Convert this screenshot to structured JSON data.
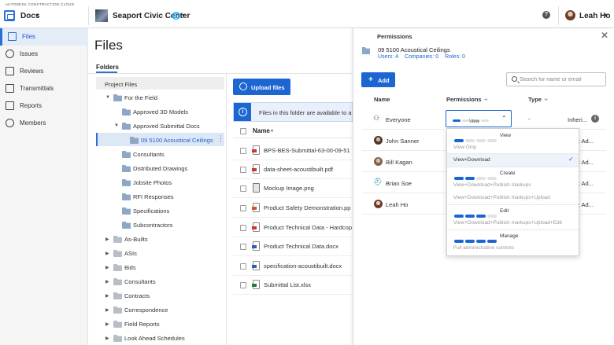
{
  "topbar": {
    "brand": "AUTODESK CONSTRUCTION CLOUD",
    "module": "Docs",
    "project": "Seaport Civic Center",
    "help": "?",
    "user": "Leah Ho"
  },
  "nav": {
    "items": [
      {
        "label": "Files",
        "icon": "folder-icon",
        "active": true
      },
      {
        "label": "Issues",
        "icon": "check-circle-icon"
      },
      {
        "label": "Reviews",
        "icon": "review-icon"
      },
      {
        "label": "Transmittals",
        "icon": "transmittal-icon"
      },
      {
        "label": "Reports",
        "icon": "report-icon"
      },
      {
        "label": "Members",
        "icon": "members-icon"
      }
    ]
  },
  "main": {
    "title": "Files",
    "tab": "Folders",
    "upload_label": "Upload files",
    "banner_text": "Files in this folder are available to a",
    "name_col": "Name",
    "sort_indicator": "^"
  },
  "tree": [
    {
      "label": "Project Files",
      "level": 0
    },
    {
      "label": "For the Field",
      "level": 1,
      "arrow": "▼"
    },
    {
      "label": "Approved 3D Models",
      "level": 2
    },
    {
      "label": "Approved Submittal Docs",
      "level": 2,
      "arrow": "▼"
    },
    {
      "label": "09 5100 Acoustical Ceilings",
      "level": 3,
      "selected": true
    },
    {
      "label": "Consultants",
      "level": 2
    },
    {
      "label": "Distributed Drawings",
      "level": 2
    },
    {
      "label": "Jobsite Photos",
      "level": 2
    },
    {
      "label": "RFI Responses",
      "level": 2
    },
    {
      "label": "Specifications",
      "level": 2
    },
    {
      "label": "Subcontractors",
      "level": 2
    },
    {
      "label": "As-Builts",
      "level": 1,
      "arrow": "▶"
    },
    {
      "label": "ASIs",
      "level": 1,
      "arrow": "▶"
    },
    {
      "label": "Bids",
      "level": 1,
      "arrow": "▶"
    },
    {
      "label": "Consultants",
      "level": 1,
      "arrow": "▶"
    },
    {
      "label": "Contracts",
      "level": 1,
      "arrow": "▶"
    },
    {
      "label": "Correspondence",
      "level": 1,
      "arrow": "▶"
    },
    {
      "label": "Field Reports",
      "level": 1,
      "arrow": "▶"
    },
    {
      "label": "Look Ahead Schedules",
      "level": 1,
      "arrow": "▶"
    }
  ],
  "files": [
    {
      "name": "BPS-BES-Submittal-63-00-09-51",
      "type": "pdf"
    },
    {
      "name": "data-sheet-acoustibuilt.pdf",
      "type": "pdf"
    },
    {
      "name": "Mockup Image.png",
      "type": "img"
    },
    {
      "name": "Product Safety Demonstration.pp",
      "type": "ppt"
    },
    {
      "name": "Product Technical Data - Hardcop",
      "type": "pdf"
    },
    {
      "name": "Product Technical Data.docx",
      "type": "docx"
    },
    {
      "name": "specification-acoustibuilt.docx",
      "type": "docx"
    },
    {
      "name": "Submittal List.xlsx",
      "type": "xlsx"
    }
  ],
  "permissions": {
    "title": "Permissions",
    "folder": "09 5100 Acoustical Ceilings",
    "users": "Users: 4",
    "companies": "Companies: 0",
    "roles": "Roles: 0",
    "add_label": "Add",
    "search_placeholder": "Search for name or email",
    "col_name": "Name",
    "col_permissions": "Permissions",
    "col_type": "Type",
    "rows": [
      {
        "name": "Everyone",
        "type": "Inheri..."
      },
      {
        "name": "John Sanner",
        "type": "oject Ad..."
      },
      {
        "name": "Bill Kagan",
        "type": "oject Ad..."
      },
      {
        "name": "Brian Soe",
        "type": "oject Ad..."
      },
      {
        "name": "Leah Ho",
        "type": "oject Ad..."
      }
    ],
    "select_value": "View",
    "type_dash": "-",
    "options": [
      {
        "label": "View",
        "desc": "View Only",
        "level": 1
      },
      {
        "label": "",
        "desc": "View+Download",
        "level": 0,
        "selected": true
      },
      {
        "label": "Create",
        "desc": "View+Download+Publish markups",
        "level": 2
      },
      {
        "label": "",
        "desc": "View+Download+Publish markups+Upload",
        "level": 0
      },
      {
        "label": "Edit",
        "desc": "View+Download+Publish markups+Upload+Edit",
        "level": 3
      },
      {
        "label": "Manage",
        "desc": "Full administrative controls",
        "level": 4
      }
    ],
    "check": "✓"
  }
}
